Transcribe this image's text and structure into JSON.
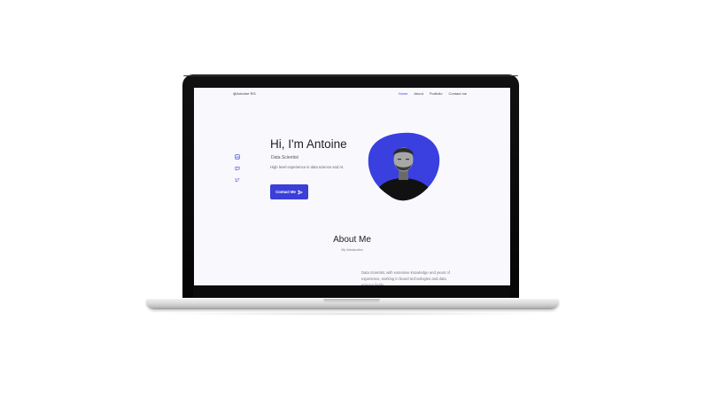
{
  "site": {
    "logo": "@Antoine RG",
    "nav": [
      {
        "label": "Home",
        "active": true
      },
      {
        "label": "About",
        "active": false
      },
      {
        "label": "Portfolio",
        "active": false
      },
      {
        "label": "Contact me",
        "active": false
      }
    ],
    "social_icons": [
      "linkedin-icon",
      "chat-icon",
      "twitter-icon"
    ]
  },
  "hero": {
    "title": "Hi, I'm Antoine",
    "subtitle": "Data Scientist",
    "description": "High level experience in data science and AI.",
    "button_label": "Contact Me",
    "button_icon": "send-icon"
  },
  "about": {
    "title": "About Me",
    "subtitle": "My introduction",
    "text": "Data Scientist, with extensive knowledge and years of experience, working in board technologies and data science fields..."
  },
  "colors": {
    "accent": "#3b3fd8",
    "screen_bg": "#f9f8fd",
    "laptop_frame": "#0b0b0b"
  }
}
